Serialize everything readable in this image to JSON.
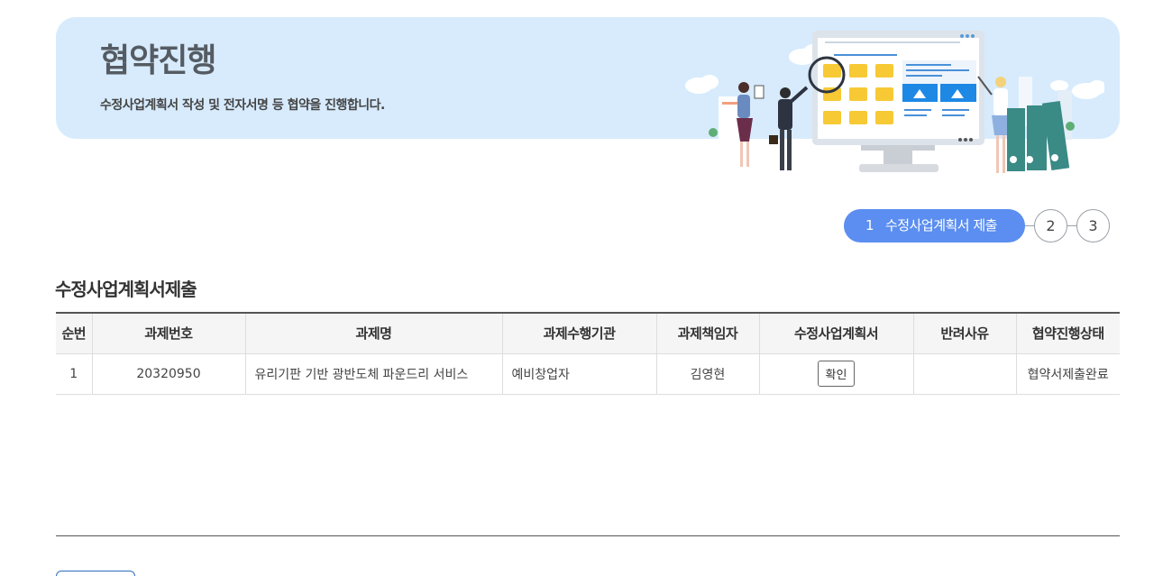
{
  "banner": {
    "title": "협약진행",
    "description": "수정사업계획서 작성 및 전자서명 등 협약을 진행합니다."
  },
  "stepper": {
    "active_number": "1",
    "active_label": "수정사업계획서 제출",
    "step2": "2",
    "step3": "3"
  },
  "section": {
    "title": "수정사업계획서제출"
  },
  "table": {
    "headers": [
      "순번",
      "과제번호",
      "과제명",
      "과제수행기관",
      "과제책임자",
      "수정사업계획서",
      "반려사유",
      "협약진행상태"
    ],
    "rows": [
      {
        "no": "1",
        "task_number": "20320950",
        "task_name": "유리기판 기반 광반도체 파운드리 서비스",
        "org": "예비창업자",
        "manager": "김영현",
        "plan_button": "확인",
        "reject_reason": "",
        "status": "협약서제출완료"
      }
    ]
  },
  "colors": {
    "banner_bg": "#d7ebfd",
    "step_active": "#5b8ef0"
  }
}
